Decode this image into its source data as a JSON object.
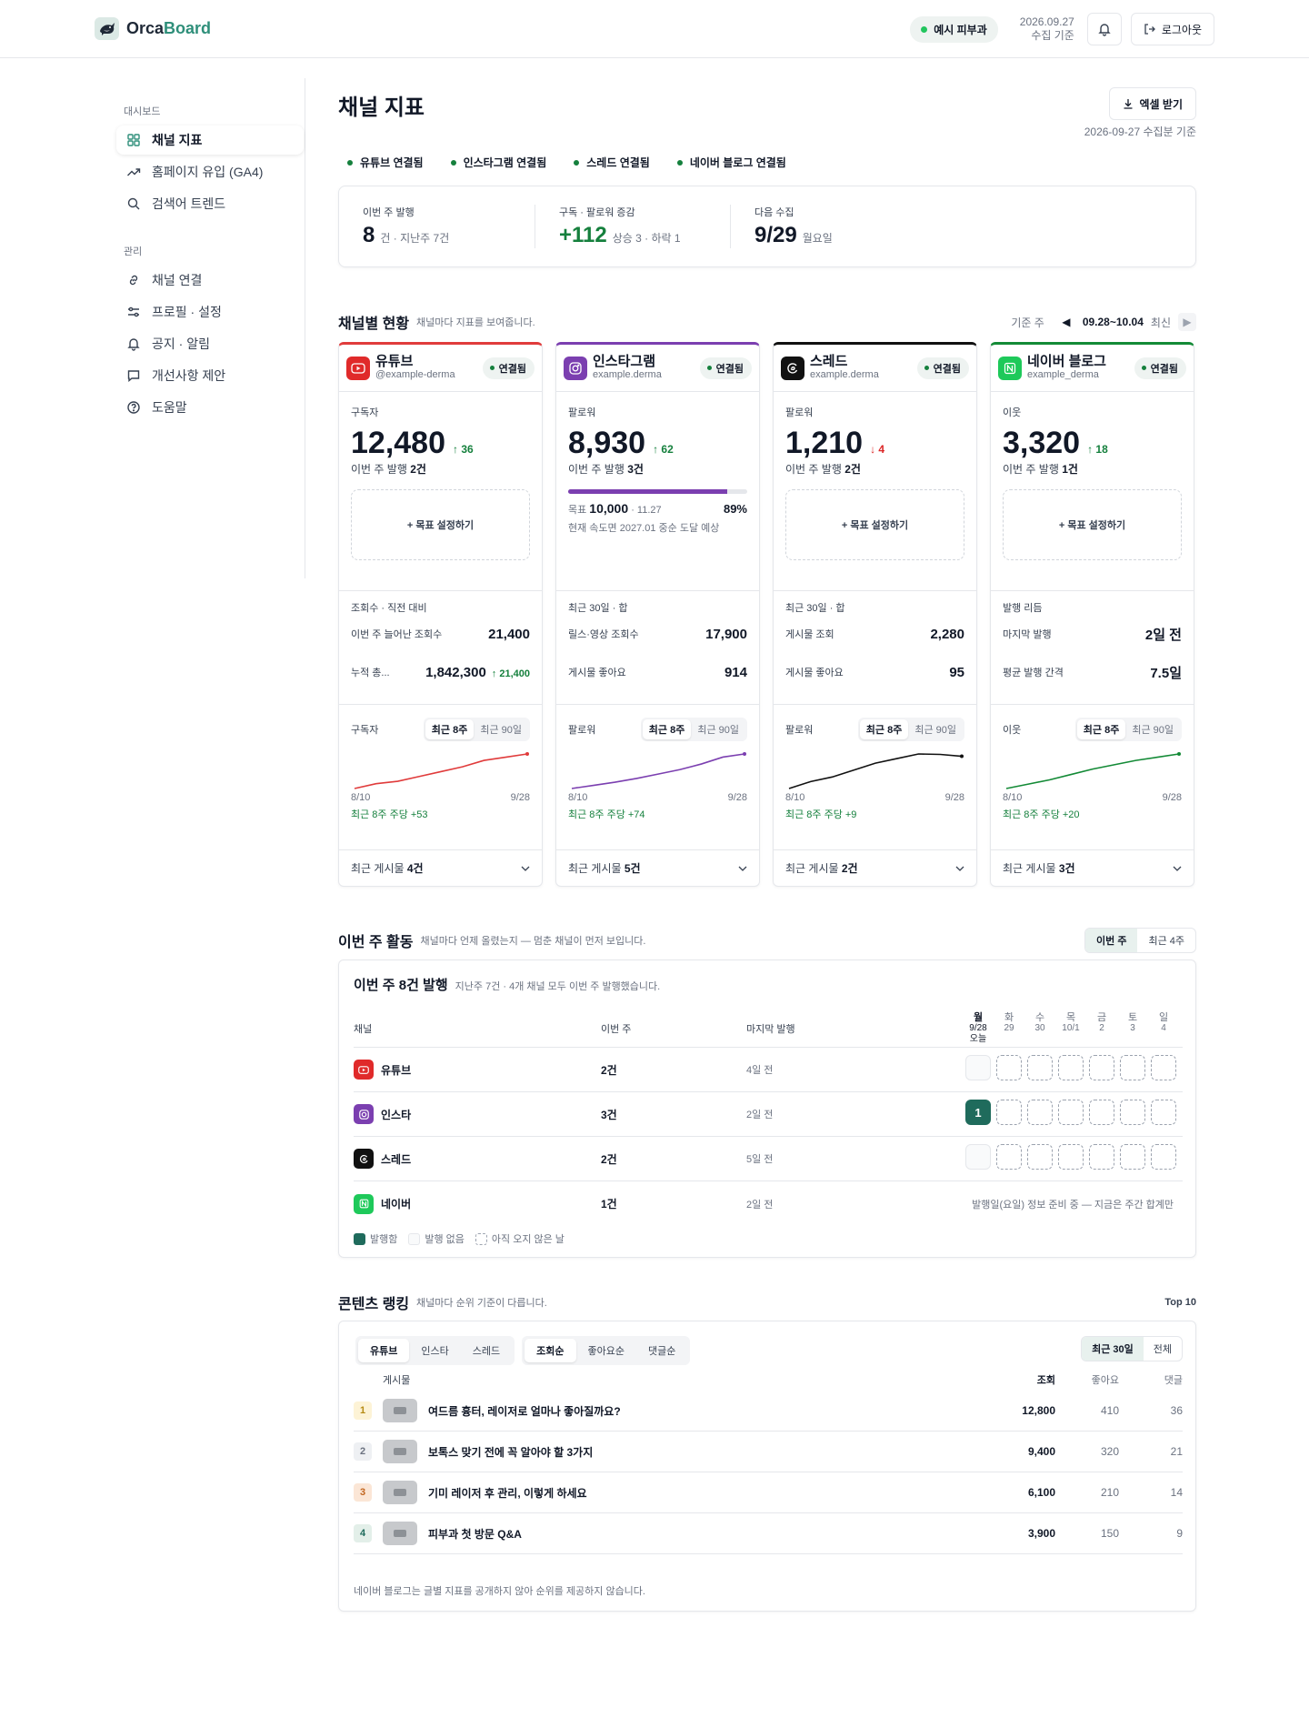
{
  "header": {
    "logo_part1": "Orca",
    "logo_part2": "Board",
    "clinic_badge": "예시 피부과",
    "date": "2026.09.27",
    "date_sub": "수집 기준",
    "logout_label": "로그아웃"
  },
  "sidebar": {
    "section_dashboard": "대시보드",
    "section_manage": "관리",
    "dashboard_items": [
      {
        "label": "채널 지표",
        "icon": "grid-icon",
        "active": true
      },
      {
        "label": "홈페이지 유입 (GA4)",
        "icon": "trend-icon"
      },
      {
        "label": "검색어 트렌드",
        "icon": "search-icon"
      }
    ],
    "manage_items": [
      {
        "label": "채널 연결",
        "icon": "link-icon"
      },
      {
        "label": "프로필 · 설정",
        "icon": "settings-icon"
      },
      {
        "label": "공지 · 알림",
        "icon": "bell-icon"
      },
      {
        "label": "개선사항 제안",
        "icon": "chat-icon"
      },
      {
        "label": "도움말",
        "icon": "help-icon"
      }
    ]
  },
  "page": {
    "title": "채널 지표",
    "excel_label": "엑셀 받기",
    "collected_note": "2026-09-27 수집분 기준",
    "connections": [
      "유튜브 연결됨",
      "인스타그램 연결됨",
      "스레드 연결됨",
      "네이버 블로그 연결됨"
    ]
  },
  "summary": {
    "publish_label": "이번 주 발행",
    "publish_value": "8",
    "publish_sub": "건 · 지난주 7건",
    "growth_label": "구독 · 팔로워 증감",
    "growth_value": "+112",
    "growth_sub": "상승 3 · 하락 1",
    "next_label": "다음 수집",
    "next_value": "9/29",
    "next_sub": "월요일"
  },
  "channels_section": {
    "title": "채널별 현황",
    "subtitle": "채널마다 지표를 보여줍니다.",
    "week_label": "기준 주",
    "week_range": "09.28~10.04",
    "week_latest": "최신",
    "connected_label": "연결됨",
    "goal_set_label": "+ 목표 설정하기",
    "seg_8w": "최근 8주",
    "seg_90d": "최근 90일",
    "x_start": "8/10",
    "x_end": "9/28"
  },
  "channels": [
    {
      "name": "유튜브",
      "handle": "@example-derma",
      "color": "#e03b3b",
      "metric_label": "구독자",
      "metric_value": "12,480",
      "delta": "↑ 36",
      "delta_dir": "up",
      "posts_prefix": "이번 주 발행 ",
      "posts": "2건",
      "stats_header": "조회수 · 직전 대비",
      "stat1_label": "이번 주 늘어난 조회수",
      "stat1_value": "21,400",
      "stat2_label": "누적 총...",
      "stat2_value": "1,842,300",
      "stat2_delta": "↑ 21,400",
      "trend_label": "구독자",
      "trend_note": "최근 8주 주당 +53",
      "trend": [
        12050,
        12110,
        12140,
        12200,
        12260,
        12320,
        12400,
        12440,
        12480
      ],
      "recent_prefix": "최근 게시물 ",
      "recent": "4건"
    },
    {
      "name": "인스타그램",
      "handle": "example.derma",
      "color": "#7b3fb0",
      "metric_label": "팔로워",
      "metric_value": "8,930",
      "delta": "↑ 62",
      "delta_dir": "up",
      "posts_prefix": "이번 주 발행 ",
      "posts": "3건",
      "goal_progress": 0.89,
      "goal_prefix": "목표 ",
      "goal_value": "10,000",
      "goal_date": "· 11.27",
      "goal_pct": "89%",
      "goal_note": "현재 속도면 2027.01 중순 도달 예상",
      "stats_header": "최근 30일 · 합",
      "stat1_label": "릴스·영상 조회수",
      "stat1_value": "17,900",
      "stat2_label": "게시물 좋아요",
      "stat2_value": "914",
      "trend_label": "팔로워",
      "trend_note": "최근 8주 주당 +74",
      "trend": [
        8380,
        8430,
        8480,
        8540,
        8610,
        8680,
        8770,
        8880,
        8930
      ],
      "recent_prefix": "최근 게시물 ",
      "recent": "5건"
    },
    {
      "name": "스레드",
      "handle": "example.derma",
      "color": "#111111",
      "metric_label": "팔로워",
      "metric_value": "1,210",
      "delta": "↓ 4",
      "delta_dir": "down",
      "posts_prefix": "이번 주 발행 ",
      "posts": "2건",
      "stats_header": "최근 30일 · 합",
      "stat1_label": "게시물 조회",
      "stat1_value": "2,280",
      "stat2_label": "게시물 좋아요",
      "stat2_value": "95",
      "trend_label": "팔로워",
      "trend_note": "최근 8주 주당 +9",
      "trend": [
        1140,
        1155,
        1165,
        1180,
        1195,
        1205,
        1215,
        1214,
        1210
      ],
      "recent_prefix": "최근 게시물 ",
      "recent": "2건"
    },
    {
      "name": "네이버 블로그",
      "handle": "example_derma",
      "color": "#138a36",
      "metric_label": "이웃",
      "metric_value": "3,320",
      "delta": "↑ 18",
      "delta_dir": "up",
      "posts_prefix": "이번 주 발행 ",
      "posts": "1건",
      "stats_header": "발행 리듬",
      "stat1_label": "마지막 발행",
      "stat1_value": "2일 전",
      "stat2_label": "평균 발행 간격",
      "stat2_value": "7.5일",
      "trend_label": "이웃",
      "trend_note": "최근 8주 주당 +20",
      "trend": [
        3160,
        3180,
        3200,
        3225,
        3250,
        3270,
        3290,
        3305,
        3320
      ],
      "recent_prefix": "최근 게시물 ",
      "recent": "3건"
    }
  ],
  "activity_section": {
    "title": "이번 주 활동",
    "subtitle": "채널마다 언제 올렸는지 — 멈춘 채널이 먼저 보입니다.",
    "tab_this": "이번 주",
    "tab_4w": "최근 4주",
    "card_title": "이번 주 8건 발행",
    "card_sub": "지난주 7건 · 4개 채널 모두 이번 주 발행했습니다.",
    "col_channel": "채널",
    "col_this_week": "이번 주",
    "col_last": "마지막 발행",
    "days": [
      {
        "d": "월",
        "date": "9/28",
        "today": "오늘"
      },
      {
        "d": "화",
        "date": "29"
      },
      {
        "d": "수",
        "date": "30"
      },
      {
        "d": "목",
        "date": "10/1"
      },
      {
        "d": "금",
        "date": "2"
      },
      {
        "d": "토",
        "date": "3"
      },
      {
        "d": "일",
        "date": "4"
      }
    ],
    "rows": [
      {
        "channel": "유튜브",
        "count": "2건",
        "last": "4일 전"
      },
      {
        "channel": "인스타",
        "count": "3건",
        "last": "2일 전",
        "posted_today": "1"
      },
      {
        "channel": "스레드",
        "count": "2건",
        "last": "5일 전"
      },
      {
        "channel": "네이버",
        "count": "1건",
        "last": "2일 전",
        "note": "발행일(요일) 정보 준비 중 — 지금은 주간 합계만"
      }
    ],
    "legend_posted": "발행함",
    "legend_none": "발행 없음",
    "legend_future": "아직 오지 않은 날"
  },
  "ranking_section": {
    "title": "콘텐츠 랭킹",
    "subtitle": "채널마다 순위 기준이 다릅니다.",
    "top_label": "Top 10",
    "channel_tabs": [
      "유튜브",
      "인스타",
      "스레드"
    ],
    "sort_tabs": [
      "조회순",
      "좋아요순",
      "댓글순"
    ],
    "range_tabs": [
      "최근 30일",
      "전체"
    ],
    "col_post": "게시물",
    "col_views": "조회",
    "col_likes": "좋아요",
    "col_comments": "댓글",
    "rows": [
      {
        "rank": "1",
        "title": "여드름 흉터, 레이저로 얼마나 좋아질까요?",
        "views": "12,800",
        "likes": "410",
        "comments": "36"
      },
      {
        "rank": "2",
        "title": "보톡스 맞기 전에 꼭 알아야 할 3가지",
        "views": "9,400",
        "likes": "320",
        "comments": "21"
      },
      {
        "rank": "3",
        "title": "기미 레이저 후 관리, 이렇게 하세요",
        "views": "6,100",
        "likes": "210",
        "comments": "14"
      },
      {
        "rank": "4",
        "title": "피부과 첫 방문 Q&A",
        "views": "3,900",
        "likes": "150",
        "comments": "9"
      }
    ],
    "note": "네이버 블로그는 글별 지표를 공개하지 않아 순위를 제공하지 않습니다."
  }
}
